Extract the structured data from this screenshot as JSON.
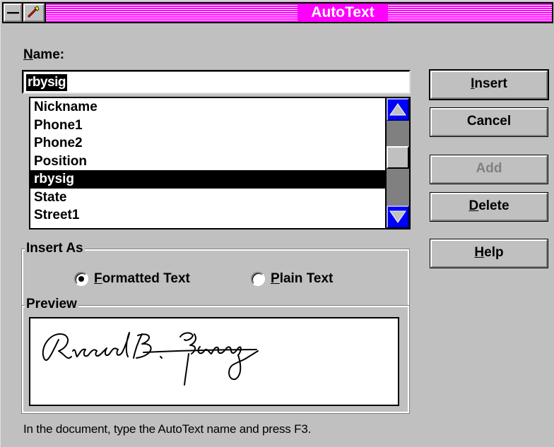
{
  "window": {
    "title": "AutoText"
  },
  "name_field": {
    "label": "Name:",
    "value": "rbysig"
  },
  "autotext_list": {
    "items": [
      "Nickname",
      "Phone1",
      "Phone2",
      "Position",
      "rbysig",
      "State",
      "Street1"
    ],
    "selected": "rbysig"
  },
  "buttons": {
    "insert": "Insert",
    "cancel": "Cancel",
    "add": "Add",
    "delete": "Delete",
    "help": "Help"
  },
  "insert_as": {
    "label": "Insert As",
    "formatted": "Formatted Text",
    "plain": "Plain Text",
    "selected": "Formatted Text"
  },
  "preview": {
    "label": "Preview",
    "signature_text": "Richard B. Young"
  },
  "status": {
    "hint": "In the document, type the AutoText name and press F3."
  },
  "colors": {
    "title_bar": "#ff00ff",
    "scroll_arrows": "#0000ff",
    "dialog_face": "#c0c0c0"
  }
}
